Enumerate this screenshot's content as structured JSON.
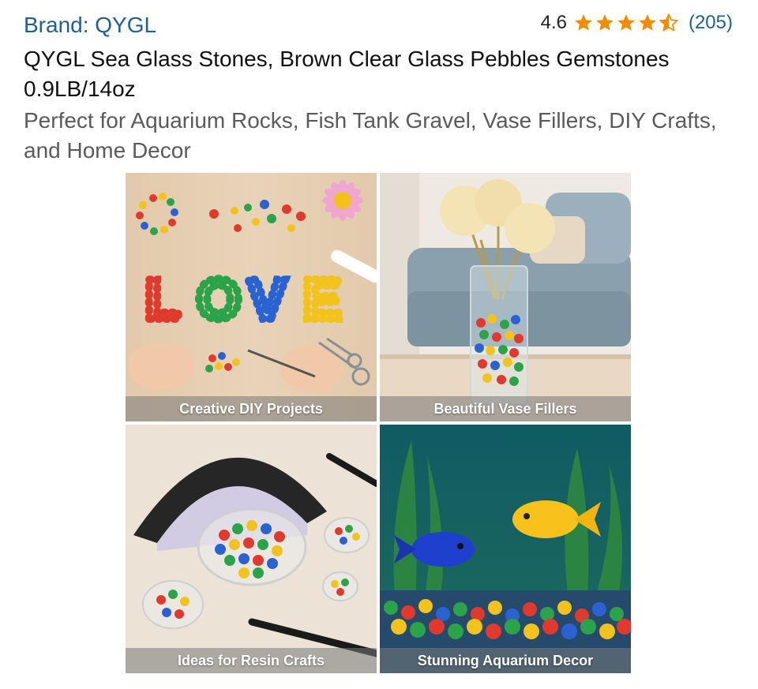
{
  "header": {
    "brand_label": "Brand: QYGL",
    "rating_value": "4.6",
    "rating_stars": 4.6,
    "rating_count": "(205)",
    "star_color": "#f08c00"
  },
  "product": {
    "title": "QYGL Sea Glass Stones, Brown Clear Glass Pebbles Gemstones 0.9LB/14oz",
    "subtitle": "Perfect for Aquarium Rocks, Fish Tank Gravel, Vase Fillers, DIY Crafts, and Home Decor"
  },
  "gallery": {
    "tiles": [
      {
        "caption": "Creative DIY Projects"
      },
      {
        "caption": "Beautiful Vase Fillers"
      },
      {
        "caption": "Ideas for Resin Crafts"
      },
      {
        "caption": "Stunning Aquarium Decor"
      }
    ]
  }
}
